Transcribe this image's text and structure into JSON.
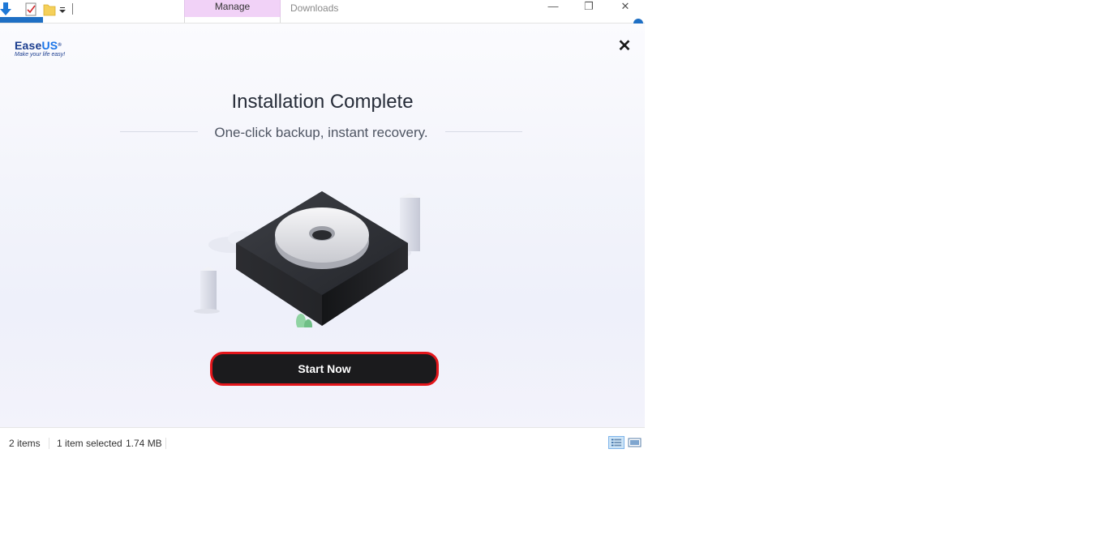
{
  "explorer": {
    "tab_manage": "Manage",
    "window_title": "Downloads",
    "controls": {
      "minimize": "—",
      "maximize": "❐",
      "close": "✕"
    },
    "qat_icons": [
      "down-arrow-icon",
      "properties-icon",
      "folder-icon",
      "dropdown-icon"
    ]
  },
  "dialog": {
    "logo": {
      "brand_main": "Ease",
      "brand_accent": "US",
      "registered": "®",
      "tagline": "Make your life easy!"
    },
    "close_glyph": "✕",
    "title": "Installation Complete",
    "subtitle": "One-click backup, instant recovery.",
    "start_button": "Start Now",
    "illustration": "backup-device-illustration"
  },
  "statusbar": {
    "items": "2 items",
    "selected": "1 item selected",
    "size": "1.74 MB",
    "view_icons": [
      "details-view-icon",
      "large-icons-view-icon"
    ]
  },
  "colors": {
    "accent_blue": "#1e6fc4",
    "manage_tab": "#f1d2f7",
    "button_bg": "#1b1b1d",
    "button_highlight": "#e3161b",
    "brand_navy": "#1b3d8f"
  }
}
